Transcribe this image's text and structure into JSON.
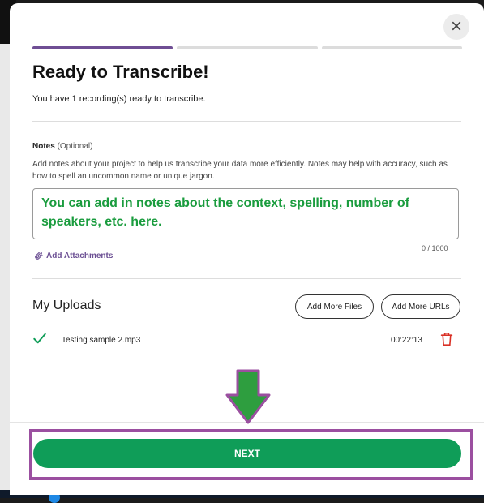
{
  "dialog": {
    "title": "Ready to Transcribe!",
    "subtitle": "You have 1 recording(s) ready to transcribe.",
    "close_icon": "×",
    "progress_steps": 3,
    "active_step": 1,
    "accent_color": "#6f4e94"
  },
  "notes": {
    "label": "Notes",
    "optional": "(Optional)",
    "help": "Add notes about your project to help us transcribe your data more efficiently. Notes may help with accuracy, such as how to spell an uncommon name or unique jargon.",
    "value": "You can add  in notes about the context, spelling, number of speakers, etc. here.",
    "counter": "0 / 1000",
    "attach_label": "Add Attachments"
  },
  "uploads": {
    "title": "My Uploads",
    "add_files_label": "Add More Files",
    "add_urls_label": "Add More URLs",
    "items": [
      {
        "name": "Testing sample 2.mp3",
        "duration": "00:22:13",
        "status_icon": "check-icon",
        "delete_icon": "trash-icon"
      }
    ]
  },
  "footer": {
    "next_label": "NEXT",
    "next_color": "#0f9d58"
  },
  "annotations": {
    "arrow_color": "#2e9e3f",
    "highlight_color": "#9b4fa0"
  }
}
